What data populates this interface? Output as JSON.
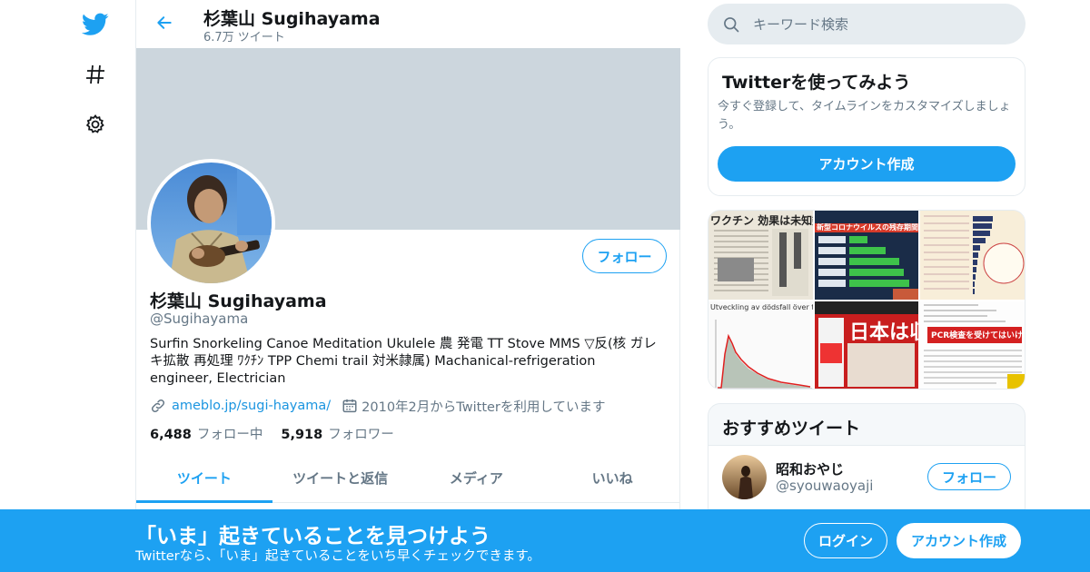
{
  "colors": {
    "accent": "#1da1f2",
    "banner": "#ccd6dd",
    "secondary_text": "#657786",
    "link": "#1b95e0"
  },
  "nav": {
    "icons": [
      "twitter-bird-icon",
      "hashtag-icon",
      "gear-icon"
    ]
  },
  "header": {
    "back_icon": "arrow-left-icon",
    "name": "杉葉山 Sugihayama",
    "tweet_count": "6.7万 ツイート"
  },
  "profile": {
    "follow_label": "フォロー",
    "name": "杉葉山 Sugihayama",
    "handle": "@Sugihayama",
    "bio": "Surfin Snorkeling Canoe Meditation Ukulele 農 発電 TT Stove MMS ▽反(核 ガレキ拡散 再処理 ﾜｸﾁﾝ TPP Chemi trail 対米隷属) Machanical-refrigeration engineer, Electrician",
    "url": "ameblo.jp/sugi-hayama/",
    "joined": "2010年2月からTwitterを利用しています",
    "following_count": "6,488",
    "following_label": "フォロー中",
    "followers_count": "5,918",
    "followers_label": "フォロワー"
  },
  "tabs": [
    {
      "label": "ツイート",
      "active": true
    },
    {
      "label": "ツイートと返信",
      "active": false
    },
    {
      "label": "メディア",
      "active": false
    },
    {
      "label": "いいね",
      "active": false
    }
  ],
  "search": {
    "placeholder": "キーワード検索"
  },
  "signup_card": {
    "title": "Twitterを使ってみよう",
    "description": "今すぐ登録して、タイムラインをカスタマイズしましょう。",
    "button": "アカウント作成"
  },
  "media_grid": {
    "thumbs": [
      {
        "text": "ワクチン 効果は未知数"
      },
      {
        "text": "新型コロナウイルスの残存期間"
      },
      {
        "text": ""
      },
      {
        "text": "Utveckling av dödsfall över tid"
      },
      {
        "text": "日本は収束"
      },
      {
        "text": "PCR検査を受けてはいけない"
      }
    ]
  },
  "recommended": {
    "title": "おすすめツイート",
    "items": [
      {
        "name": "昭和おやじ",
        "handle": "@syouwaoyaji",
        "follow": "フォロー"
      }
    ]
  },
  "bottom_bar": {
    "title": "「いま」起きていることを見つけよう",
    "subtitle": "Twitterなら、「いま」起きていることをいち早くチェックできます。",
    "login": "ログイン",
    "signup": "アカウント作成"
  }
}
